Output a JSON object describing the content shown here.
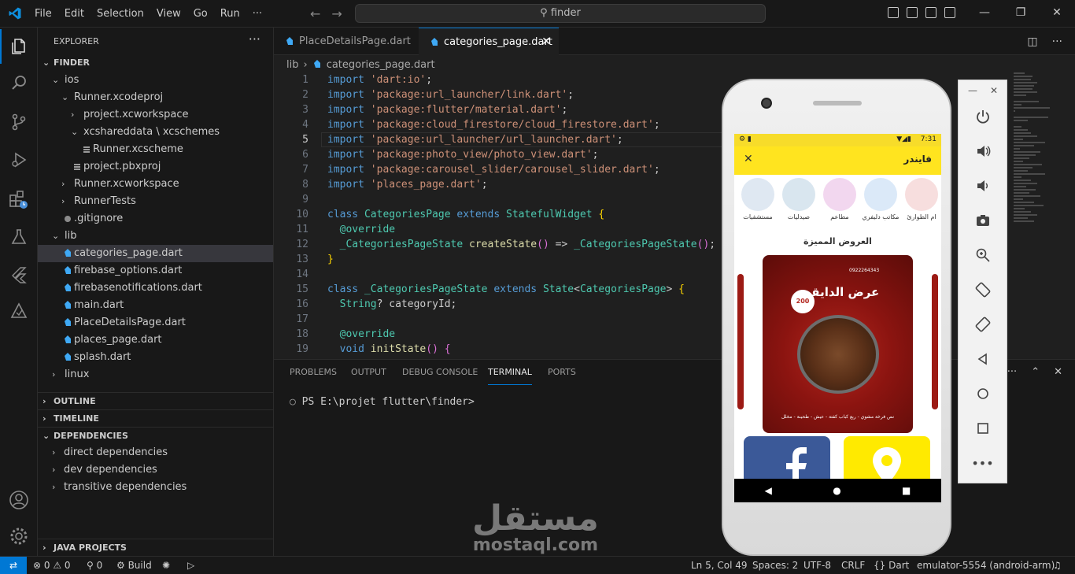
{
  "menu": [
    "File",
    "Edit",
    "Selection",
    "View",
    "Go",
    "Run",
    "···"
  ],
  "search_text": "finder",
  "explorer": {
    "title": "EXPLORER",
    "root": "FINDER",
    "tree": [
      {
        "label": "ios",
        "indent": 1,
        "kind": "folder-open"
      },
      {
        "label": "Runner.xcodeproj",
        "indent": 2,
        "kind": "folder-open"
      },
      {
        "label": "project.xcworkspace",
        "indent": 3,
        "kind": "folder"
      },
      {
        "label": "xcshareddata \\ xcschemes",
        "indent": 3,
        "kind": "folder-open"
      },
      {
        "label": "Runner.xcscheme",
        "indent": 4,
        "kind": "file"
      },
      {
        "label": "project.pbxproj",
        "indent": 3,
        "kind": "file"
      },
      {
        "label": "Runner.xcworkspace",
        "indent": 2,
        "kind": "folder"
      },
      {
        "label": "RunnerTests",
        "indent": 2,
        "kind": "folder"
      },
      {
        "label": ".gitignore",
        "indent": 2,
        "kind": "gear"
      },
      {
        "label": "lib",
        "indent": 1,
        "kind": "folder-open"
      },
      {
        "label": "categories_page.dart",
        "indent": 2,
        "kind": "dart",
        "selected": true
      },
      {
        "label": "firebase_options.dart",
        "indent": 2,
        "kind": "dart"
      },
      {
        "label": "firebasenotifications.dart",
        "indent": 2,
        "kind": "dart"
      },
      {
        "label": "main.dart",
        "indent": 2,
        "kind": "dart"
      },
      {
        "label": "PlaceDetailsPage.dart",
        "indent": 2,
        "kind": "dart"
      },
      {
        "label": "places_page.dart",
        "indent": 2,
        "kind": "dart"
      },
      {
        "label": "splash.dart",
        "indent": 2,
        "kind": "dart"
      },
      {
        "label": "linux",
        "indent": 1,
        "kind": "folder"
      }
    ],
    "sections": {
      "outline": "OUTLINE",
      "timeline": "TIMELINE",
      "dependencies": "DEPENDENCIES",
      "java": "JAVA PROJECTS"
    },
    "deps": [
      "direct dependencies",
      "dev dependencies",
      "transitive dependencies"
    ]
  },
  "tabs": [
    {
      "label": "PlaceDetailsPage.dart",
      "active": false
    },
    {
      "label": "categories_page.dart",
      "active": true
    }
  ],
  "breadcrumb": {
    "folder": "lib",
    "file": "categories_page.dart"
  },
  "code": {
    "current_line": 5,
    "lines": [
      [
        [
          "kw",
          "import"
        ],
        [
          "punc",
          " "
        ],
        [
          "str",
          "'dart:io'"
        ],
        [
          "punc",
          ";"
        ]
      ],
      [
        [
          "kw",
          "import"
        ],
        [
          "punc",
          " "
        ],
        [
          "str",
          "'package:url_launcher/link.dart'"
        ],
        [
          "punc",
          ";"
        ]
      ],
      [
        [
          "kw",
          "import"
        ],
        [
          "punc",
          " "
        ],
        [
          "str",
          "'package:flutter/material.dart'"
        ],
        [
          "punc",
          ";"
        ]
      ],
      [
        [
          "kw",
          "import"
        ],
        [
          "punc",
          " "
        ],
        [
          "str",
          "'package:cloud_firestore/cloud_firestore.dart'"
        ],
        [
          "punc",
          ";"
        ]
      ],
      [
        [
          "kw",
          "import"
        ],
        [
          "punc",
          " "
        ],
        [
          "str",
          "'package:url_launcher/url_launcher.dart'"
        ],
        [
          "punc",
          ";"
        ]
      ],
      [
        [
          "kw",
          "import"
        ],
        [
          "punc",
          " "
        ],
        [
          "str",
          "'package:photo_view/photo_view.dart'"
        ],
        [
          "punc",
          ";"
        ]
      ],
      [
        [
          "kw",
          "import"
        ],
        [
          "punc",
          " "
        ],
        [
          "str",
          "'package:carousel_slider/carousel_slider.dart'"
        ],
        [
          "punc",
          ";"
        ]
      ],
      [
        [
          "kw",
          "import"
        ],
        [
          "punc",
          " "
        ],
        [
          "str",
          "'places_page.dart'"
        ],
        [
          "punc",
          ";"
        ]
      ],
      [],
      [
        [
          "kw",
          "class"
        ],
        [
          "punc",
          " "
        ],
        [
          "cls",
          "CategoriesPage"
        ],
        [
          "punc",
          " "
        ],
        [
          "kw",
          "extends"
        ],
        [
          "punc",
          " "
        ],
        [
          "cls",
          "StatefulWidget"
        ],
        [
          "punc",
          " "
        ],
        [
          "brk",
          "{"
        ]
      ],
      [
        [
          "punc",
          "  "
        ],
        [
          "ann",
          "@override"
        ]
      ],
      [
        [
          "punc",
          "  "
        ],
        [
          "cls",
          "_CategoriesPageState"
        ],
        [
          "punc",
          " "
        ],
        [
          "fn",
          "createState"
        ],
        [
          "brk2",
          "()"
        ],
        [
          "punc",
          " => "
        ],
        [
          "cls",
          "_CategoriesPageState"
        ],
        [
          "brk2",
          "()"
        ],
        [
          "punc",
          ";"
        ]
      ],
      [
        [
          "brk",
          "}"
        ]
      ],
      [],
      [
        [
          "kw",
          "class"
        ],
        [
          "punc",
          " "
        ],
        [
          "cls",
          "_CategoriesPageState"
        ],
        [
          "punc",
          " "
        ],
        [
          "kw",
          "extends"
        ],
        [
          "punc",
          " "
        ],
        [
          "cls",
          "State"
        ],
        [
          "punc",
          "<"
        ],
        [
          "cls",
          "CategoriesPage"
        ],
        [
          "punc",
          "> "
        ],
        [
          "brk",
          "{"
        ]
      ],
      [
        [
          "punc",
          "  "
        ],
        [
          "cls",
          "String"
        ],
        [
          "punc",
          "? categoryId;"
        ]
      ],
      [],
      [
        [
          "punc",
          "  "
        ],
        [
          "ann",
          "@override"
        ]
      ],
      [
        [
          "punc",
          "  "
        ],
        [
          "kw",
          "void"
        ],
        [
          "punc",
          " "
        ],
        [
          "fn",
          "initState"
        ],
        [
          "brk2",
          "()"
        ],
        [
          "punc",
          " "
        ],
        [
          "brk2",
          "{"
        ]
      ]
    ]
  },
  "panel": {
    "tabs": [
      "PROBLEMS",
      "OUTPUT",
      "DEBUG CONSOLE",
      "TERMINAL",
      "PORTS"
    ],
    "active": "TERMINAL",
    "prompt": "PS E:\\projet flutter\\finder>"
  },
  "statusbar": {
    "errors": "0",
    "warnings": "0",
    "ports": "0",
    "build": "Build",
    "position": "Ln 5, Col 49",
    "spaces": "Spaces: 2",
    "encoding": "UTF-8",
    "eol": "CRLF",
    "language": "Dart",
    "device": "emulator-5554 (android-arm)"
  },
  "phone": {
    "time": "7:31",
    "app_title": "فايندر",
    "categories": [
      {
        "label": "مستشفيات",
        "color": "#dfe8f2"
      },
      {
        "label": "صيدليات",
        "color": "#d9e6ef"
      },
      {
        "label": "مطاعم",
        "color": "#f2d7ef"
      },
      {
        "label": "مكاتب دليفري",
        "color": "#dbe9f8"
      },
      {
        "label": "ام الطوارئ",
        "color": "#f7dede"
      }
    ],
    "featured_title": "العروض المميزة",
    "banner": {
      "headline": "عرض الدايقين",
      "price": "200",
      "phone": "0922264343",
      "footer": "نص فرخة مشوي - ربع كباب كفتة - عيش - طحينة - مخلل"
    }
  },
  "watermark": {
    "ar": "مستقل",
    "en": "mostaql.com"
  }
}
